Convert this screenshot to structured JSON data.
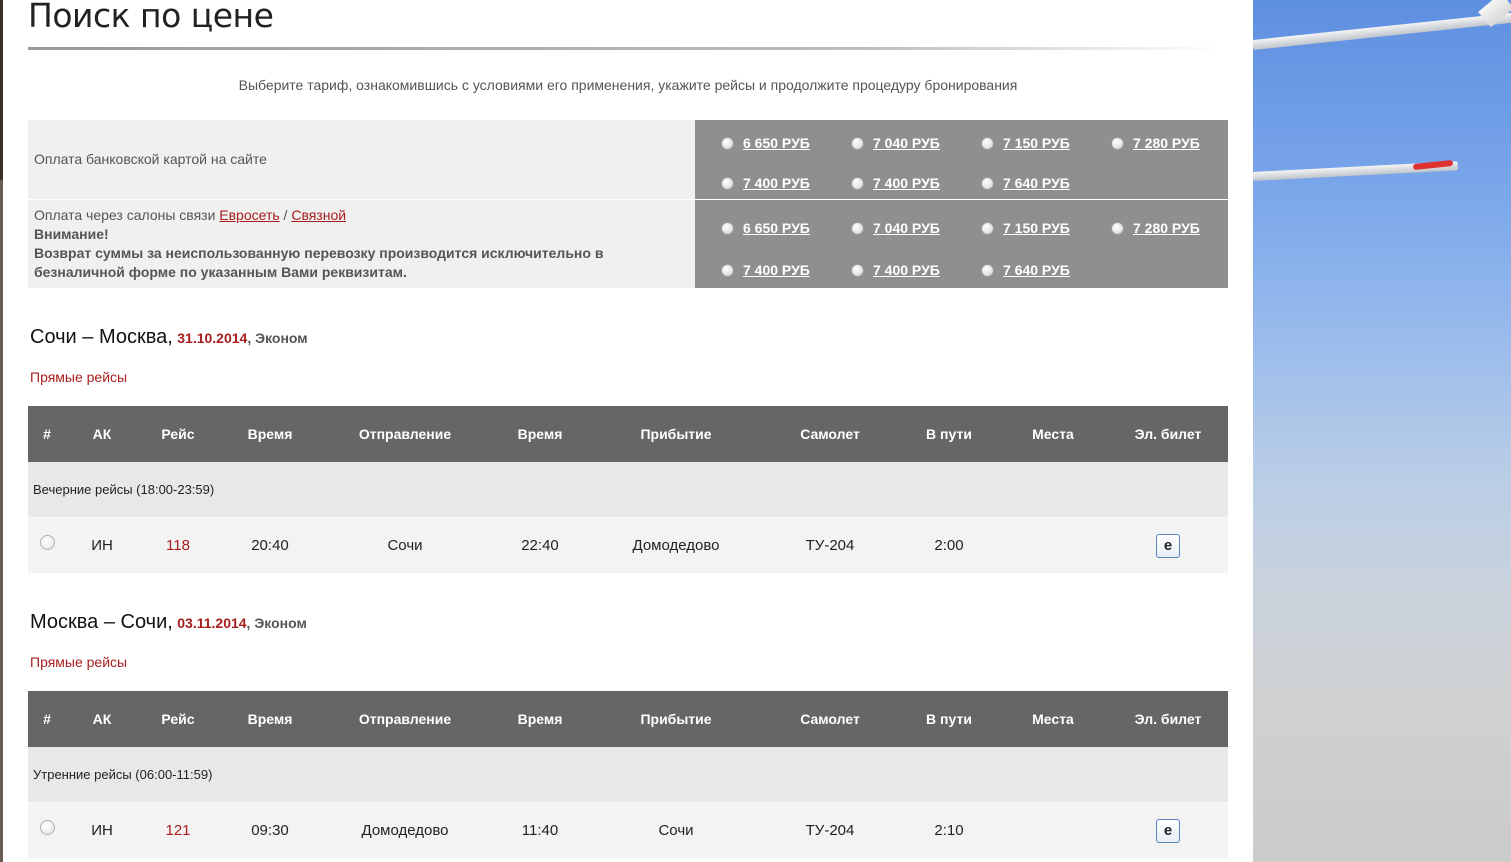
{
  "page": {
    "title": "Поиск по цене",
    "intro": "Выберите тариф, ознакомившись с условиями его применения, укажите рейсы и продолжите процедуру бронирования"
  },
  "tariffs": [
    {
      "label": "Оплата банковской картой на сайте",
      "prices": [
        "6 650 РУБ",
        "7 040 РУБ",
        "7 150 РУБ",
        "7 280 РУБ",
        "7 400 РУБ",
        "7 400 РУБ",
        "7 640 РУБ"
      ]
    },
    {
      "label_prefix": "Оплата через салоны связи",
      "link1": "Евросеть",
      "separator": "/",
      "link2": "Связной",
      "warning_title": "Внимание!",
      "warning_text": "Возврат суммы за неиспользованную перевозку производится исключительно в безналичной форме по указанным Вами реквизитам.",
      "prices": [
        "6 650 РУБ",
        "7 040 РУБ",
        "7 150 РУБ",
        "7 280 РУБ",
        "7 400 РУБ",
        "7 400 РУБ",
        "7 640 РУБ"
      ]
    }
  ],
  "columns": [
    "#",
    "АК",
    "Рейс",
    "Время",
    "Отправление",
    "Время",
    "Прибытие",
    "Самолет",
    "В пути",
    "Места",
    "Эл. билет"
  ],
  "routes": [
    {
      "title": "Сочи – Москва,",
      "date": "31.10.2014",
      "class": ", Эконом",
      "direct_label": "Прямые рейсы",
      "group": "Вечерние рейсы (18:00-23:59)",
      "flight": {
        "airline": "ИН",
        "number": "118",
        "dep_time": "20:40",
        "departure": "Сочи",
        "arr_time": "22:40",
        "arrival": "Домодедово",
        "aircraft": "ТУ-204",
        "duration": "2:00",
        "seats": "",
        "eticket_icon": "e"
      }
    },
    {
      "title": "Москва – Сочи,",
      "date": "03.11.2014",
      "class": ", Эконом",
      "direct_label": "Прямые рейсы",
      "group": "Утренние рейсы (06:00-11:59)",
      "flight": {
        "airline": "ИН",
        "number": "121",
        "dep_time": "09:30",
        "departure": "Домодедово",
        "arr_time": "11:40",
        "arrival": "Сочи",
        "aircraft": "ТУ-204",
        "duration": "2:10",
        "seats": "",
        "eticket_icon": "e"
      }
    }
  ]
}
